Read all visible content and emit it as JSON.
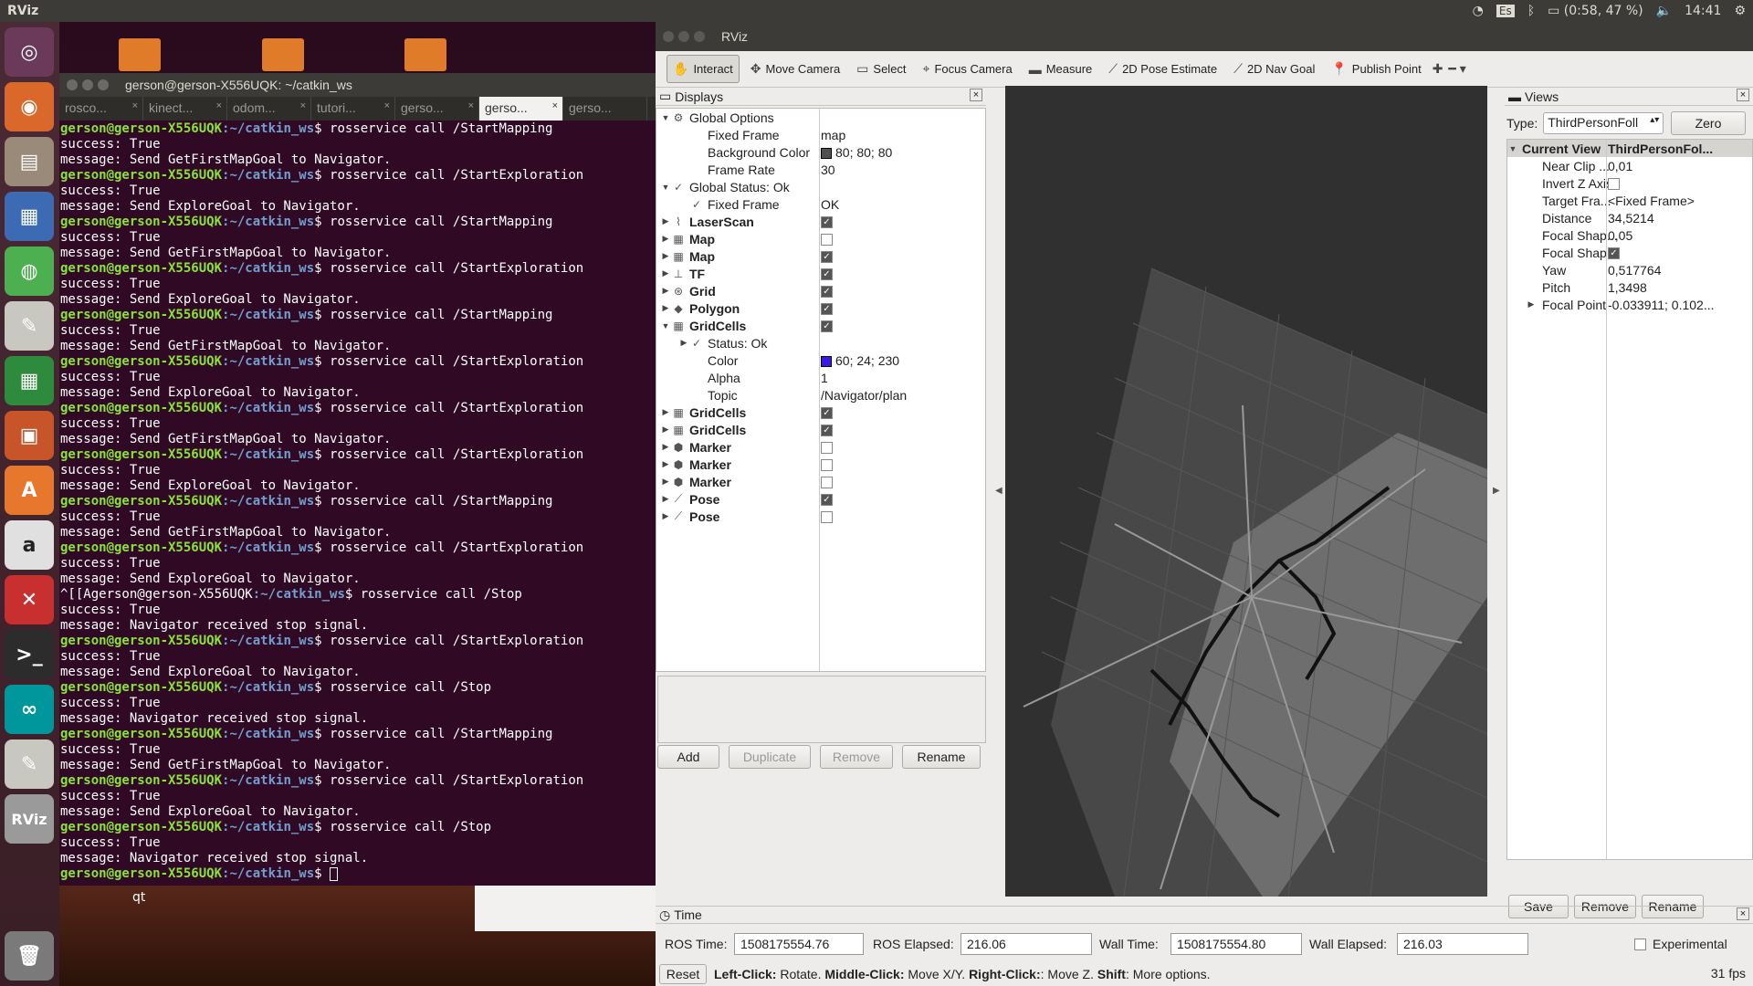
{
  "topbar": {
    "app": "RViz",
    "keyboard": "Es",
    "battery": "(0:58, 47 %)",
    "time": "14:41"
  },
  "desktop": {
    "qt_label": "qt"
  },
  "terminal": {
    "title": "gerson@gerson-X556UQK: ~/catkin_ws",
    "tabs": [
      "rosco...",
      "kinect...",
      "odom...",
      "tutori...",
      "gerso...",
      "gerso...",
      "gerso..."
    ],
    "prompt_user": "gerson@gerson-X556UQK",
    "prompt_dir": ":~/catkin_ws",
    "lines": [
      {
        "t": "cmd",
        "v": "$ rosservice call /StartMapping"
      },
      {
        "t": "out",
        "v": "success: True"
      },
      {
        "t": "out",
        "v": "message: Send GetFirstMapGoal to Navigator."
      },
      {
        "t": "cmd",
        "v": "$ rosservice call /StartExploration"
      },
      {
        "t": "out",
        "v": "success: True"
      },
      {
        "t": "out",
        "v": "message: Send ExploreGoal to Navigator."
      },
      {
        "t": "cmd",
        "v": "$ rosservice call /StartMapping"
      },
      {
        "t": "out",
        "v": "success: True"
      },
      {
        "t": "out",
        "v": "message: Send GetFirstMapGoal to Navigator."
      },
      {
        "t": "cmd",
        "v": "$ rosservice call /StartExploration"
      },
      {
        "t": "out",
        "v": "success: True"
      },
      {
        "t": "out",
        "v": "message: Send ExploreGoal to Navigator."
      },
      {
        "t": "cmd",
        "v": "$ rosservice call /StartMapping"
      },
      {
        "t": "out",
        "v": "success: True"
      },
      {
        "t": "out",
        "v": "message: Send GetFirstMapGoal to Navigator."
      },
      {
        "t": "cmd",
        "v": "$ rosservice call /StartExploration"
      },
      {
        "t": "out",
        "v": "success: True"
      },
      {
        "t": "out",
        "v": "message: Send ExploreGoal to Navigator."
      },
      {
        "t": "cmd",
        "v": "$ rosservice call /StartExploration"
      },
      {
        "t": "out",
        "v": "success: True"
      },
      {
        "t": "out",
        "v": "message: Send GetFirstMapGoal to Navigator."
      },
      {
        "t": "cmd",
        "v": "$ rosservice call /StartExploration"
      },
      {
        "t": "out",
        "v": "success: True"
      },
      {
        "t": "out",
        "v": "message: Send ExploreGoal to Navigator."
      },
      {
        "t": "cmd",
        "v": "$ rosservice call /StartMapping"
      },
      {
        "t": "out",
        "v": "success: True"
      },
      {
        "t": "out",
        "v": "message: Send GetFirstMapGoal to Navigator."
      },
      {
        "t": "cmd",
        "v": "$ rosservice call /StartExploration"
      },
      {
        "t": "out",
        "v": "success: True"
      },
      {
        "t": "out",
        "v": "message: Send ExploreGoal to Navigator."
      },
      {
        "t": "cmd2",
        "v": "$ rosservice call /Stop"
      },
      {
        "t": "out",
        "v": "success: True"
      },
      {
        "t": "out",
        "v": "message: Navigator received stop signal."
      },
      {
        "t": "cmd",
        "v": "$ rosservice call /StartExploration"
      },
      {
        "t": "out",
        "v": "success: True"
      },
      {
        "t": "out",
        "v": "message: Send ExploreGoal to Navigator."
      },
      {
        "t": "cmd",
        "v": "$ rosservice call /Stop"
      },
      {
        "t": "out",
        "v": "success: True"
      },
      {
        "t": "out",
        "v": "message: Navigator received stop signal."
      },
      {
        "t": "cmd",
        "v": "$ rosservice call /StartMapping"
      },
      {
        "t": "out",
        "v": "success: True"
      },
      {
        "t": "out",
        "v": "message: Send GetFirstMapGoal to Navigator."
      },
      {
        "t": "cmd",
        "v": "$ rosservice call /StartExploration"
      },
      {
        "t": "out",
        "v": "success: True"
      },
      {
        "t": "out",
        "v": "message: Send ExploreGoal to Navigator."
      },
      {
        "t": "cmd",
        "v": "$ rosservice call /Stop"
      },
      {
        "t": "out",
        "v": "success: True"
      },
      {
        "t": "out",
        "v": "message: Navigator received stop signal."
      },
      {
        "t": "prompt",
        "v": "$ "
      }
    ],
    "interrupt_prefix": "^[[A"
  },
  "rviz": {
    "title": "RViz",
    "toolbar": [
      "Interact",
      "Move Camera",
      "Select",
      "Focus Camera",
      "Measure",
      "2D Pose Estimate",
      "2D Nav Goal",
      "Publish Point"
    ],
    "toolbar_icons": [
      "hand-icon",
      "move-camera-icon",
      "select-icon",
      "focus-camera-icon",
      "measure-icon",
      "pose-estimate-icon",
      "nav-goal-icon",
      "publish-point-icon"
    ],
    "displays": {
      "title": "Displays",
      "rows": [
        {
          "level": 0,
          "arrow": "down",
          "icon": "gear",
          "name": "Global Options",
          "value": "",
          "bold": false
        },
        {
          "level": 1,
          "arrow": "",
          "icon": "",
          "name": "Fixed Frame",
          "value": "map"
        },
        {
          "level": 1,
          "arrow": "",
          "icon": "",
          "name": "Background Color",
          "value": "80; 80; 80",
          "swatch": "#505050"
        },
        {
          "level": 1,
          "arrow": "",
          "icon": "",
          "name": "Frame Rate",
          "value": "30"
        },
        {
          "level": 0,
          "arrow": "down",
          "icon": "check",
          "name": "Global Status: Ok",
          "value": ""
        },
        {
          "level": 1,
          "arrow": "",
          "icon": "check",
          "name": "Fixed Frame",
          "value": "OK"
        },
        {
          "level": 0,
          "arrow": "right",
          "icon": "laser",
          "name": "LaserScan",
          "check": true,
          "bold": true
        },
        {
          "level": 0,
          "arrow": "right",
          "icon": "grid",
          "name": "Map",
          "check": false,
          "bold": true
        },
        {
          "level": 0,
          "arrow": "right",
          "icon": "grid",
          "name": "Map",
          "check": true,
          "bold": true
        },
        {
          "level": 0,
          "arrow": "right",
          "icon": "tf",
          "name": "TF",
          "check": true,
          "bold": true
        },
        {
          "level": 0,
          "arrow": "right",
          "icon": "gridicon",
          "name": "Grid",
          "check": true,
          "bold": true
        },
        {
          "level": 0,
          "arrow": "right",
          "icon": "poly",
          "name": "Polygon",
          "check": true,
          "bold": true
        },
        {
          "level": 0,
          "arrow": "down",
          "icon": "grid",
          "name": "GridCells",
          "check": true,
          "bold": true
        },
        {
          "level": 1,
          "arrow": "right",
          "icon": "check",
          "name": "Status: Ok",
          "value": ""
        },
        {
          "level": 1,
          "arrow": "",
          "icon": "",
          "name": "Color",
          "value": "60; 24; 230",
          "swatch": "#3c18e6"
        },
        {
          "level": 1,
          "arrow": "",
          "icon": "",
          "name": "Alpha",
          "value": "1"
        },
        {
          "level": 1,
          "arrow": "",
          "icon": "",
          "name": "Topic",
          "value": "/Navigator/plan"
        },
        {
          "level": 0,
          "arrow": "right",
          "icon": "grid",
          "name": "GridCells",
          "check": true,
          "bold": true
        },
        {
          "level": 0,
          "arrow": "right",
          "icon": "grid",
          "name": "GridCells",
          "check": true,
          "bold": true
        },
        {
          "level": 0,
          "arrow": "right",
          "icon": "cube",
          "name": "Marker",
          "check": false,
          "bold": true
        },
        {
          "level": 0,
          "arrow": "right",
          "icon": "cube",
          "name": "Marker",
          "check": false,
          "bold": true
        },
        {
          "level": 0,
          "arrow": "right",
          "icon": "cube",
          "name": "Marker",
          "check": false,
          "bold": true
        },
        {
          "level": 0,
          "arrow": "right",
          "icon": "pose",
          "name": "Pose",
          "check": true,
          "bold": true
        },
        {
          "level": 0,
          "arrow": "right",
          "icon": "pose",
          "name": "Pose",
          "check": false,
          "bold": true
        }
      ],
      "buttons": [
        "Add",
        "Duplicate",
        "Remove",
        "Rename"
      ]
    },
    "views": {
      "title": "Views",
      "type_label": "Type:",
      "type_value": "ThirdPersonFoll",
      "zero": "Zero",
      "header": {
        "name": "Current View",
        "value": "ThirdPersonFol..."
      },
      "rows": [
        {
          "name": "Near Clip ...",
          "value": "0,01"
        },
        {
          "name": "Invert Z Axis",
          "check": false
        },
        {
          "name": "Target Fra...",
          "value": "<Fixed Frame>"
        },
        {
          "name": "Distance",
          "value": "34,5214"
        },
        {
          "name": "Focal Shap...",
          "value": "0,05"
        },
        {
          "name": "Focal Shap...",
          "check": true
        },
        {
          "name": "Yaw",
          "value": "0,517764"
        },
        {
          "name": "Pitch",
          "value": "1,3498"
        },
        {
          "name": "Focal Point",
          "value": "-0.033911; 0.102...",
          "arrow": true
        }
      ],
      "buttons": [
        "Save",
        "Remove",
        "Rename"
      ]
    },
    "time": {
      "title": "Time",
      "ros_time_label": "ROS Time:",
      "ros_time": "1508175554.76",
      "ros_elapsed_label": "ROS Elapsed:",
      "ros_elapsed": "216.06",
      "wall_time_label": "Wall Time:",
      "wall_time": "1508175554.80",
      "wall_elapsed_label": "Wall Elapsed:",
      "wall_elapsed": "216.03",
      "experimental": "Experimental"
    },
    "status": {
      "reset": "Reset",
      "help": [
        {
          "b": "Left-Click:",
          "t": " Rotate. "
        },
        {
          "b": "Middle-Click:",
          "t": " Move X/Y. "
        },
        {
          "b": "Right-Click:",
          "t": ": Move Z. "
        },
        {
          "b": "Shift",
          "t": ": More options."
        }
      ],
      "fps": "31 fps"
    }
  }
}
